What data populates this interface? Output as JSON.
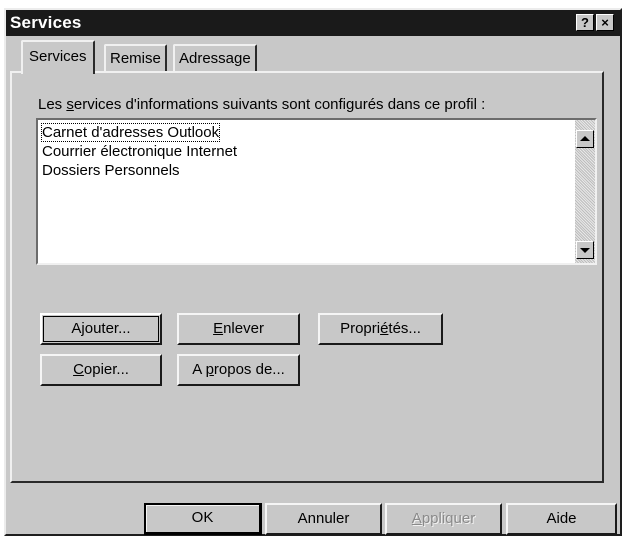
{
  "window": {
    "title": "Services",
    "help_label": "?",
    "close_label": "×"
  },
  "tabs": [
    {
      "label": "Services",
      "active": true
    },
    {
      "label": "Remise",
      "active": false
    },
    {
      "label": "Adressage",
      "active": false
    }
  ],
  "services_panel": {
    "description_pre": "Les ",
    "description_accel": "s",
    "description_post": "ervices d'informations suivants sont configurés dans ce profil :",
    "items": [
      "Carnet d'adresses Outlook",
      "Courrier électronique Internet",
      "Dossiers Personnels"
    ],
    "buttons": {
      "add": {
        "label": "Ajouter..."
      },
      "remove": {
        "pre": "",
        "accel": "E",
        "post": "nlever"
      },
      "properties": {
        "pre": "Propri",
        "accel": "é",
        "post": "tés..."
      },
      "copy": {
        "pre": "",
        "accel": "C",
        "post": "opier..."
      },
      "about": {
        "pre": "A ",
        "accel": "p",
        "post": "ropos de..."
      }
    }
  },
  "footer": {
    "ok": "OK",
    "cancel": "Annuler",
    "apply": {
      "pre": "",
      "accel": "A",
      "post": "ppliquer"
    },
    "help": "Aide"
  }
}
